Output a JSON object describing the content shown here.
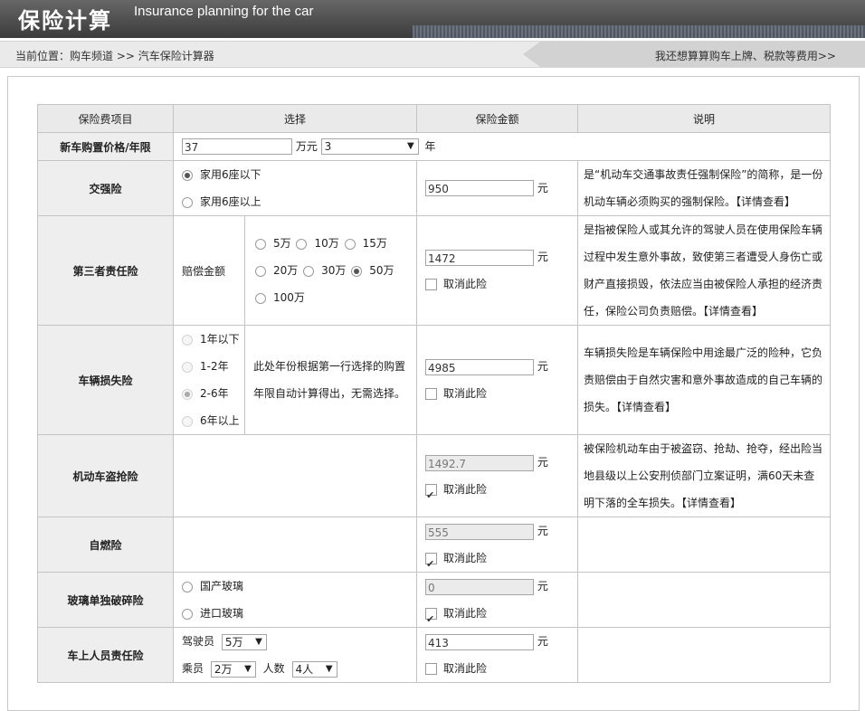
{
  "header": {
    "logo_text": "保险计算",
    "subtitle": "Insurance planning for the car"
  },
  "breadcrumb": {
    "prefix": "当前位置：",
    "channel": "购车频道",
    "sep": ">>",
    "current": "汽车保险计算器",
    "right_link": "我还想算算购车上牌、税款等费用>>"
  },
  "table": {
    "headers": [
      "保险费项目",
      "选择",
      "保险金额",
      "说明"
    ],
    "price_row": {
      "label": "新车购置价格/年限",
      "price": "37",
      "price_unit": "万元",
      "years_selected": "3",
      "years_unit": "年"
    },
    "compulsory": {
      "label": "交强险",
      "options": [
        {
          "text": "家用6座以下",
          "checked": true
        },
        {
          "text": "家用6座以上",
          "checked": false
        }
      ],
      "amount": "950",
      "unit": "元",
      "desc": "是“机动车交通事故责任强制保险”的简称，是一份机动车辆必须购买的强制保险。",
      "link": "【详情查看】"
    },
    "third_party": {
      "label": "第三者责任险",
      "sub_label": "赔偿金额",
      "options": [
        {
          "text": "5万",
          "checked": false
        },
        {
          "text": "10万",
          "checked": false
        },
        {
          "text": "15万",
          "checked": false
        },
        {
          "text": "20万",
          "checked": false
        },
        {
          "text": "30万",
          "checked": false
        },
        {
          "text": "50万",
          "checked": true
        },
        {
          "text": "100万",
          "checked": false
        }
      ],
      "amount": "1472",
      "unit": "元",
      "cancel": "取消此险",
      "desc": "是指被保险人或其允许的驾驶人员在使用保险车辆过程中发生意外事故，致使第三者遭受人身伤亡或财产直接损毁，依法应当由被保险人承担的经济责任，保险公司负责赔偿。",
      "link": "【详情查看】"
    },
    "vehicle_loss": {
      "label": "车辆损失险",
      "options": [
        {
          "text": "1年以下",
          "checked": false
        },
        {
          "text": "1-2年",
          "checked": false
        },
        {
          "text": "2-6年",
          "checked": true
        },
        {
          "text": "6年以上",
          "checked": false
        }
      ],
      "note": "此处年份根据第一行选择的购置年限自动计算得出，无需选择。",
      "amount": "4985",
      "unit": "元",
      "cancel": "取消此险",
      "desc": "车辆损失险是车辆保险中用途最广泛的险种，它负责赔偿由于自然灾害和意外事故造成的自己车辆的损失。",
      "link": "【详情查看】"
    },
    "theft": {
      "label": "机动车盗抢险",
      "amount": "1492.7",
      "unit": "元",
      "cancel": "取消此险",
      "cancel_checked": true,
      "desc": "被保险机动车由于被盗窃、抢劫、抢夺，经出险当地县级以上公安刑侦部门立案证明，满60天未查明下落的全车损失。",
      "link": "【详情查看】"
    },
    "spontaneous": {
      "label": "自燃险",
      "amount": "555",
      "unit": "元",
      "cancel": "取消此险",
      "cancel_checked": true
    },
    "glass": {
      "label": "玻璃单独破碎险",
      "options": [
        {
          "text": "国产玻璃",
          "checked": false
        },
        {
          "text": "进口玻璃",
          "checked": false
        }
      ],
      "amount": "0",
      "unit": "元",
      "cancel": "取消此险",
      "cancel_checked": true
    },
    "passenger": {
      "label": "车上人员责任险",
      "driver_label": "驾驶员",
      "driver_value": "5万",
      "passenger_label": "乘员",
      "passenger_value": "2万",
      "count_label": "人数",
      "count_value": "4人",
      "amount": "413",
      "unit": "元",
      "cancel": "取消此险",
      "cancel_checked": false
    }
  }
}
